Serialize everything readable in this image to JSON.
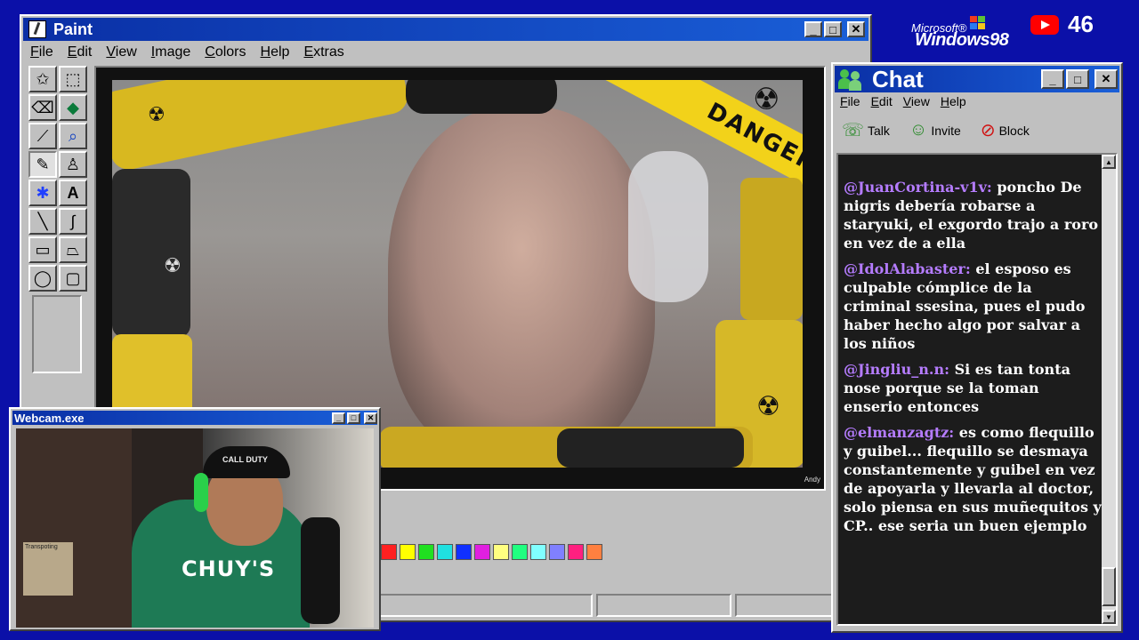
{
  "desktop": {
    "logo_small": "Microsoft®",
    "logo_big": "Windows98",
    "viewer_count": "46"
  },
  "paint": {
    "title": "Paint",
    "menus": [
      "File",
      "Edit",
      "View",
      "Image",
      "Colors",
      "Help",
      "Extras"
    ],
    "canvas_text": "DANGER",
    "credit": "Andy",
    "palette": [
      "#ff2020",
      "#ffff00",
      "#20e020",
      "#20e0e0",
      "#1030ff",
      "#e020e0",
      "#ffff80",
      "#20ff80",
      "#80ffff",
      "#8080ff",
      "#ff2080",
      "#ff8040"
    ]
  },
  "webcam": {
    "title": "Webcam.exe",
    "cap_text": "CALL DUTY",
    "shirt_text": "CHUY'S",
    "poster_text": "Transpoting"
  },
  "chat": {
    "title": "Chat",
    "menus": [
      "File",
      "Edit",
      "View",
      "Help"
    ],
    "toolbar": {
      "talk": "Talk",
      "invite": "Invite",
      "block": "Block"
    },
    "messages": [
      {
        "user": "@JuanCortina-v1v:",
        "text": "poncho De nigris debería robarse a staryuki, el exgordo trajo a roro en vez de a ella"
      },
      {
        "user": "@IdolAlabaster:",
        "text": "el esposo es culpable cómplice de la criminal ssesina, pues el pudo haber hecho algo por salvar a los niños"
      },
      {
        "user": "@Jingliu_n.n:",
        "text": "Si es tan tonta nose porque se la toman enserio entonces"
      },
      {
        "user": "@elmanzagtz:",
        "text": "es como flequillo y guibel... flequillo se desmaya constantemente y guibel en vez de apoyarla y llevarla al doctor, solo piensa en sus muñequitos y CP.. ese seria un buen ejemplo"
      }
    ]
  },
  "colors": {
    "title_blue": "#1040c0",
    "desktop_blue": "#0b10a8",
    "chat_bg": "#1c1c1c",
    "username": "#b57cff",
    "danger_yellow": "#f2d21a"
  }
}
